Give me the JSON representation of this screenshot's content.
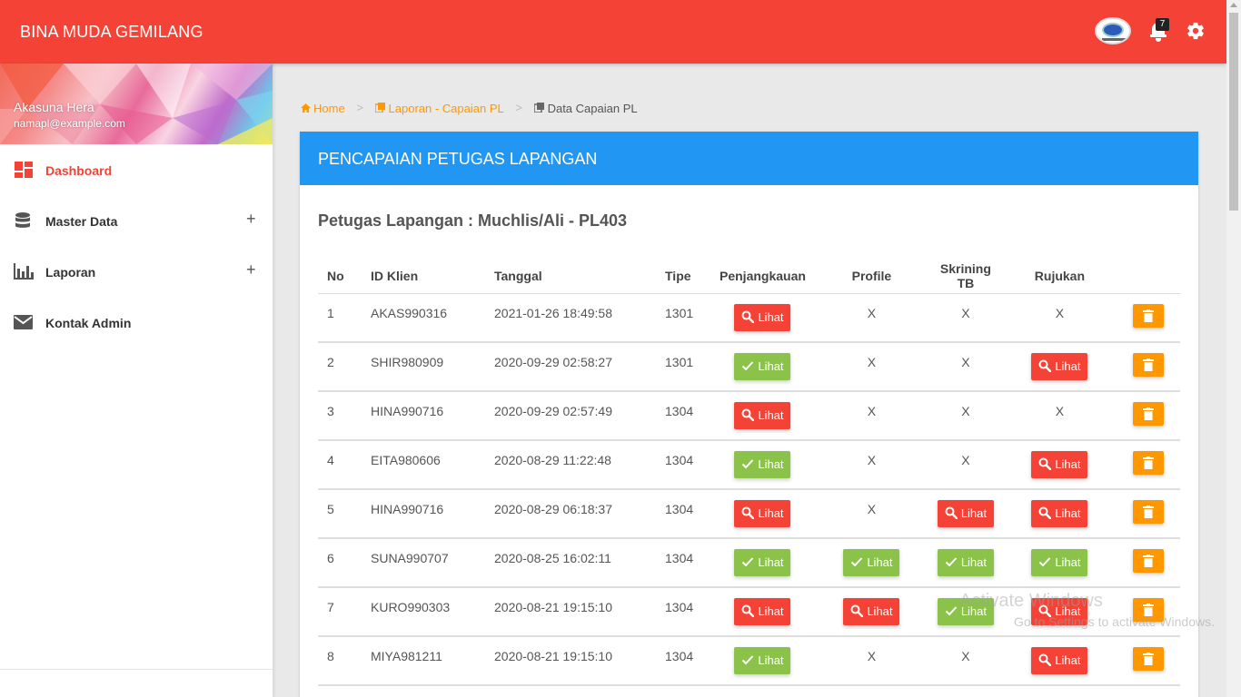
{
  "app": {
    "brand": "BINA MUDA GEMILANG",
    "notification_count": "7"
  },
  "user": {
    "name": "Akasuna Hera",
    "email": "namapl@example.com"
  },
  "sidebar": {
    "items": [
      {
        "label": "Dashboard",
        "icon": "dashboard-icon",
        "active": true
      },
      {
        "label": "Master Data",
        "icon": "database-icon",
        "expand": "+"
      },
      {
        "label": "Laporan",
        "icon": "bar-chart-icon",
        "expand": "+"
      },
      {
        "label": "Kontak Admin",
        "icon": "mail-icon"
      }
    ]
  },
  "breadcrumb": {
    "home": "Home",
    "laporan": "Laporan - Capaian PL",
    "current": "Data Capaian PL"
  },
  "card": {
    "header": "PENCAPAIAN PETUGAS LAPANGAN",
    "subtitle": "Petugas Lapangan : Muchlis/Ali - PL403"
  },
  "table": {
    "columns": [
      "No",
      "ID Klien",
      "Tanggal",
      "Tipe",
      "Penjangkauan",
      "Profile",
      "Skrining TB",
      "Rujukan"
    ],
    "button_label": "Lihat",
    "empty_mark": "X",
    "rows": [
      {
        "no": "1",
        "id": "AKAS990316",
        "date": "2021-01-26 18:49:58",
        "tipe": "1301",
        "penjangkauan": "red",
        "profile": "X",
        "skrining": "X",
        "rujukan": "X"
      },
      {
        "no": "2",
        "id": "SHIR980909",
        "date": "2020-09-29 02:58:27",
        "tipe": "1301",
        "penjangkauan": "green",
        "profile": "X",
        "skrining": "X",
        "rujukan": "red"
      },
      {
        "no": "3",
        "id": "HINA990716",
        "date": "2020-09-29 02:57:49",
        "tipe": "1304",
        "penjangkauan": "red",
        "profile": "X",
        "skrining": "X",
        "rujukan": "X"
      },
      {
        "no": "4",
        "id": "EITA980606",
        "date": "2020-08-29 11:22:48",
        "tipe": "1304",
        "penjangkauan": "green",
        "profile": "X",
        "skrining": "X",
        "rujukan": "red"
      },
      {
        "no": "5",
        "id": "HINA990716",
        "date": "2020-08-29 06:18:37",
        "tipe": "1304",
        "penjangkauan": "red",
        "profile": "X",
        "skrining": "red",
        "rujukan": "red"
      },
      {
        "no": "6",
        "id": "SUNA990707",
        "date": "2020-08-25 16:02:11",
        "tipe": "1304",
        "penjangkauan": "green",
        "profile": "green",
        "skrining": "green",
        "rujukan": "green"
      },
      {
        "no": "7",
        "id": "KURO990303",
        "date": "2020-08-21 19:15:10",
        "tipe": "1304",
        "penjangkauan": "red",
        "profile": "red",
        "skrining": "green",
        "rujukan": "red"
      },
      {
        "no": "8",
        "id": "MIYA981211",
        "date": "2020-08-21 19:15:10",
        "tipe": "1304",
        "penjangkauan": "green",
        "profile": "X",
        "skrining": "X",
        "rujukan": "red"
      }
    ]
  },
  "watermark": {
    "line1": "Activate Windows",
    "line2": "Go to Settings to activate Windows."
  },
  "colors": {
    "topbar": "#f44336",
    "card_header": "#2196f3",
    "btn_red": "#f44336",
    "btn_green": "#8bc34a",
    "btn_delete": "#ff9800",
    "breadcrumb_link": "#ff9800"
  }
}
